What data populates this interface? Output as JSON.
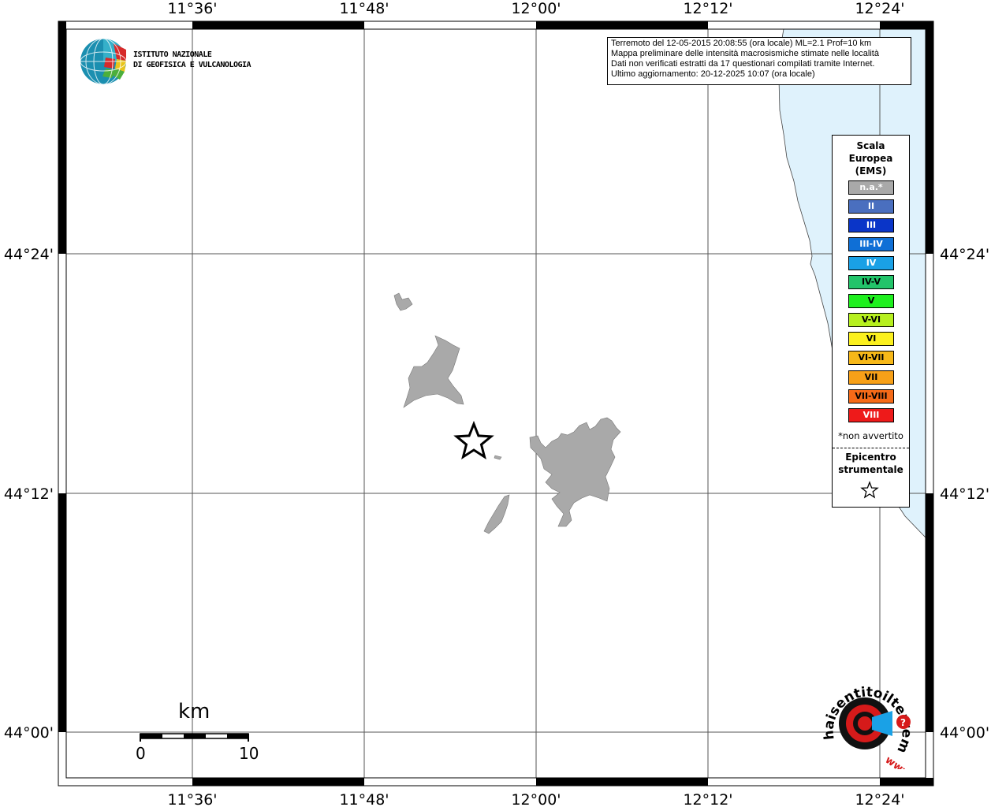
{
  "map": {
    "top_lon_labels": [
      "11°36'",
      "11°48'",
      "12°00'",
      "12°12'",
      "12°24'"
    ],
    "bottom_lon_labels": [
      "11°36'",
      "11°48'",
      "12°00'",
      "12°12'",
      "12°24'"
    ],
    "left_lat_labels": [
      "44°24'",
      "44°12'",
      "44°00'"
    ],
    "right_lat_labels": [
      "44°24'",
      "44°12'",
      "44°00'"
    ],
    "colors": {
      "land_shade": "#a9a9a9",
      "sea": "#dff2fc",
      "frame": "#000000"
    }
  },
  "info_box": {
    "line1": "Terremoto del 12-05-2015 20:08:55 (ora locale) ML=2.1 Prof=10 km",
    "line2": "Mappa preliminare delle intensità macrosismiche stimate nelle località",
    "line3": "Dati non verificati estratti da 17 questionari compilati tramite Internet.",
    "line4": "Ultimo aggiornamento: 20-12-2025 10:07 (ora locale)"
  },
  "logo": {
    "line1": "ISTITUTO NAZIONALE",
    "line2": "DI GEOFISICA E VULCANOLOGIA"
  },
  "legend": {
    "title1": "Scala",
    "title2": "Europea",
    "title3": "(EMS)",
    "items": [
      {
        "label": "n.a.*",
        "color": "#a9a9a9",
        "text_color": "#ffffff"
      },
      {
        "label": "II",
        "color": "#4a6fbf",
        "text_color": "#ffffff"
      },
      {
        "label": "III",
        "color": "#0a35c8",
        "text_color": "#ffffff"
      },
      {
        "label": "III-IV",
        "color": "#0f6fd6",
        "text_color": "#ffffff"
      },
      {
        "label": "IV",
        "color": "#1aa1e6",
        "text_color": "#ffffff"
      },
      {
        "label": "IV-V",
        "color": "#22c46a",
        "text_color": "#000000"
      },
      {
        "label": "V",
        "color": "#1ef01e",
        "text_color": "#000000"
      },
      {
        "label": "V-VI",
        "color": "#b6f01e",
        "text_color": "#000000"
      },
      {
        "label": "VI",
        "color": "#fbf01e",
        "text_color": "#000000"
      },
      {
        "label": "VI-VII",
        "color": "#f7b818",
        "text_color": "#000000"
      },
      {
        "label": "VII",
        "color": "#f7a018",
        "text_color": "#000000"
      },
      {
        "label": "VII-VIII",
        "color": "#f56a18",
        "text_color": "#000000"
      },
      {
        "label": "VIII",
        "color": "#ee1a1a",
        "text_color": "#ffffff"
      }
    ],
    "not_felt_note": "*non avvertito",
    "epicenter_label1": "Epicentro",
    "epicenter_label2": "strumentale"
  },
  "scale_bar": {
    "unit": "km",
    "start": "0",
    "end": "10"
  },
  "haisentito": {
    "brand": "haisentitoilterremoto.it",
    "prefix": "www.",
    "question": "?"
  }
}
